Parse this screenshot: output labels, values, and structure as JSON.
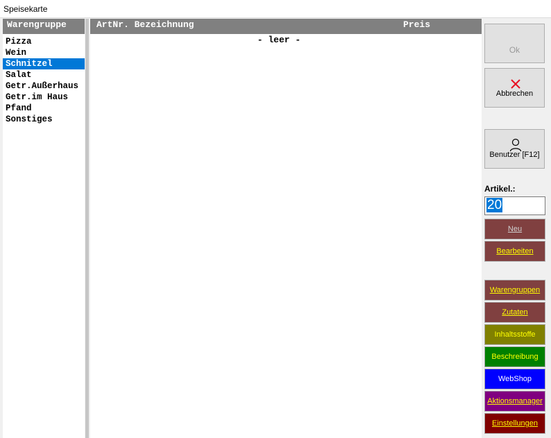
{
  "window": {
    "title": "Speisekarte"
  },
  "groups": {
    "header": "Warengruppe",
    "items": [
      "Pizza",
      "Wein",
      "Schnitzel",
      "Salat",
      "Getr.Außerhaus",
      "Getr.im Haus",
      "Pfand",
      "Sonstiges"
    ],
    "selected": "Schnitzel"
  },
  "articles": {
    "columns": {
      "artnr": "ArtNr.",
      "bezeichnung": "Bezeichnung",
      "preis": "Preis"
    },
    "empty_text": "- leer -"
  },
  "buttons": {
    "ok": "Ok",
    "abbrechen": "Abbrechen",
    "benutzer": "Benutzer [F12]"
  },
  "artikel": {
    "label": "Artikel.:",
    "value": "20"
  },
  "actions": [
    {
      "label": "Neu",
      "bg": "#804040",
      "fg": "#d0d0d0"
    },
    {
      "label": "Bearbeiten",
      "bg": "#804040",
      "fg": "#ffff00"
    },
    {
      "label": "Warengruppen",
      "bg": "#804040",
      "fg": "#ffff00"
    },
    {
      "label": "Zutaten",
      "bg": "#804040",
      "fg": "#ffff00"
    },
    {
      "label": "Inhaltsstoffe",
      "bg": "#808000",
      "fg": "#ffff00"
    },
    {
      "label": "Beschreibung",
      "bg": "#008000",
      "fg": "#ffff00"
    },
    {
      "label": "WebShop",
      "bg": "#0000ff",
      "fg": "#ffffff"
    },
    {
      "label": "Aktionsmanager",
      "bg": "#800080",
      "fg": "#ffff00"
    },
    {
      "label": "Einstellungen",
      "bg": "#800000",
      "fg": "#ffff00"
    }
  ],
  "icons": {
    "abbrechen": "close-icon",
    "benutzer": "user-icon"
  }
}
